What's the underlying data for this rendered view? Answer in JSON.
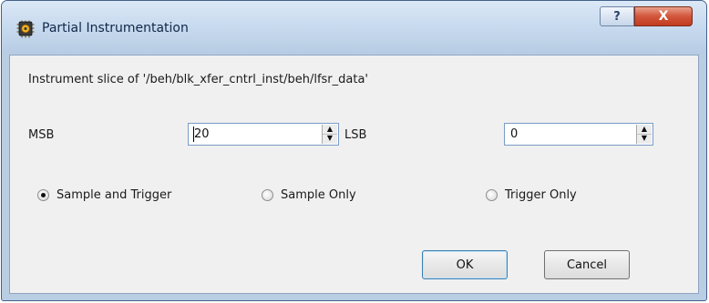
{
  "window": {
    "title": "Partial Instrumentation",
    "icon": "chip-gear-icon",
    "help_glyph": "?",
    "close_glyph": "X"
  },
  "dialog": {
    "description": "Instrument slice of '/beh/blk_xfer_cntrl_inst/beh/lfsr_data'",
    "msb": {
      "label": "MSB",
      "value": "20"
    },
    "lsb": {
      "label": "LSB",
      "value": "0"
    },
    "options": [
      {
        "label": "Sample and Trigger",
        "checked": true
      },
      {
        "label": "Sample Only",
        "checked": false
      },
      {
        "label": "Trigger Only",
        "checked": false
      }
    ],
    "ok_label": "OK",
    "cancel_label": "Cancel"
  },
  "colors": {
    "titlebar": "#c9dbef",
    "close_button": "#c23b20",
    "client_background": "#f0f0f0"
  }
}
